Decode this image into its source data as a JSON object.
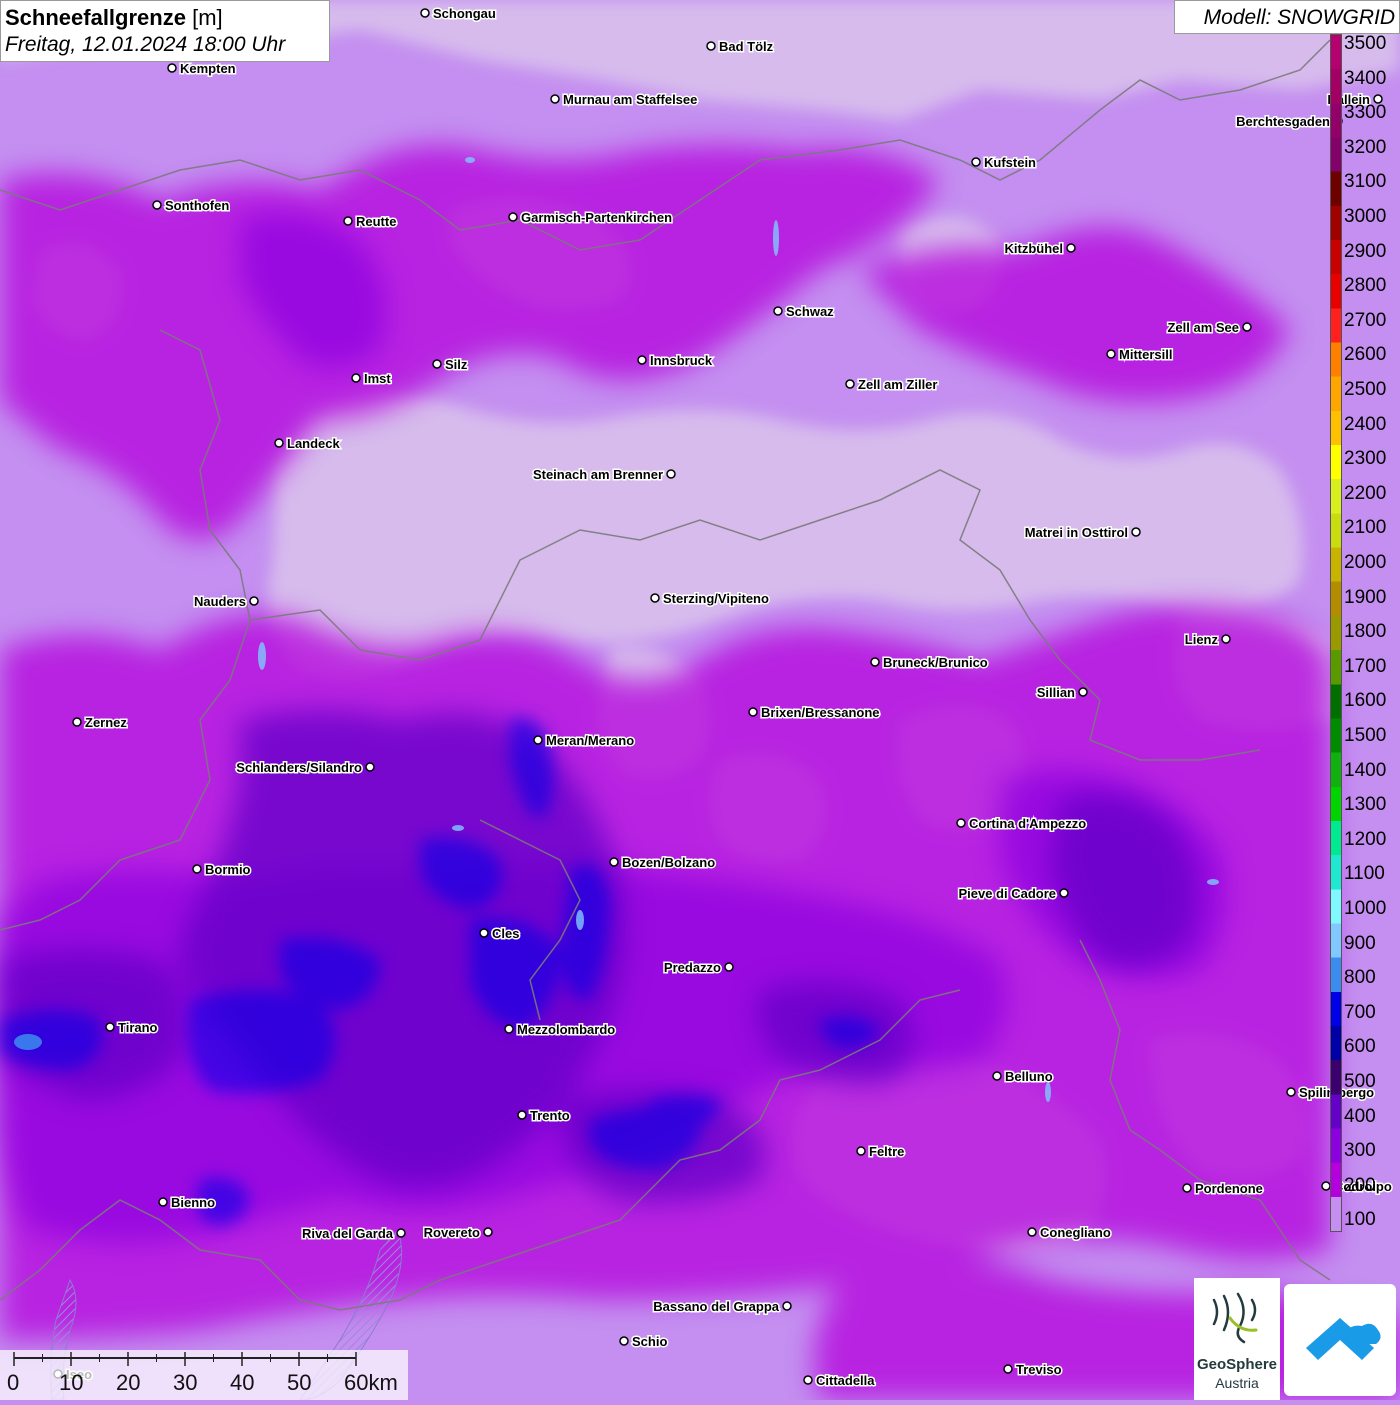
{
  "header": {
    "title": "Schneefallgrenze",
    "unit": "[m]",
    "datetime": "Freitag, 12.01.2024 18:00 Uhr"
  },
  "model": {
    "label": "Modell: SNOWGRID"
  },
  "legend": {
    "labels": [
      "3500",
      "3400",
      "3300",
      "3200",
      "3100",
      "3000",
      "2900",
      "2800",
      "2700",
      "2600",
      "2500",
      "2400",
      "2300",
      "2200",
      "2100",
      "2000",
      "1900",
      "1800",
      "1700",
      "1600",
      "1500",
      "1400",
      "1300",
      "1200",
      "1100",
      "1000",
      "900",
      "800",
      "700",
      "600",
      "500",
      "400",
      "300",
      "200",
      "100"
    ],
    "colors": [
      "#b5006f",
      "#a30066",
      "#94006a",
      "#84006b",
      "#6e0000",
      "#a00000",
      "#c80000",
      "#e80000",
      "#ff2020",
      "#ff8000",
      "#ffa500",
      "#ffc000",
      "#ffff00",
      "#d8f020",
      "#c8dc10",
      "#c8b400",
      "#b48c00",
      "#9a9a00",
      "#5a9a00",
      "#006e00",
      "#008c00",
      "#10b010",
      "#00d400",
      "#00e890",
      "#20e8d0",
      "#80f8ff",
      "#80c8ff",
      "#3c8cf0",
      "#0000e8",
      "#0000a8",
      "#3c006e",
      "#6400c8",
      "#8c00e0",
      "#b400dc",
      "#c48ff0"
    ]
  },
  "map": {
    "layer_colors": {
      "snowline_below_100": "#c48ff0",
      "snowline_100_200": "#b400dc",
      "snowline_200_300": "#8c00e0",
      "snowline_300_400": "#6400c8",
      "snowline_400_500": "#3c006e",
      "snowline_600_700": "#0000e8",
      "snowline_700_800": "#3c8cf0",
      "snow_free": "#e8e8e8",
      "borders": "#7a7a7a",
      "lakes": "#80c8ff"
    },
    "cities": [
      {
        "name": "Schongau"
      },
      {
        "name": "Bad Tölz"
      },
      {
        "name": "Kempten"
      },
      {
        "name": "Murnau am Staffelsee"
      },
      {
        "name": "Hallein"
      },
      {
        "name": "Berchtesgaden"
      },
      {
        "name": "Kufstein"
      },
      {
        "name": "Sonthofen"
      },
      {
        "name": "Reutte"
      },
      {
        "name": "Garmisch-Partenkirchen"
      },
      {
        "name": "Kitzbühel"
      },
      {
        "name": "Schwaz"
      },
      {
        "name": "Zell am See"
      },
      {
        "name": "Mittersill"
      },
      {
        "name": "Innsbruck"
      },
      {
        "name": "Imst"
      },
      {
        "name": "Silz"
      },
      {
        "name": "Zell am Ziller"
      },
      {
        "name": "Landeck"
      },
      {
        "name": "Steinach am Brenner"
      },
      {
        "name": "Matrei in Osttirol"
      },
      {
        "name": "Nauders"
      },
      {
        "name": "Sterzing/Vipiteno"
      },
      {
        "name": "Lienz"
      },
      {
        "name": "Bruneck/Brunico"
      },
      {
        "name": "Sillian"
      },
      {
        "name": "Zernez"
      },
      {
        "name": "Brixen/Bressanone"
      },
      {
        "name": "Meran/Merano"
      },
      {
        "name": "Schlanders/Silandro"
      },
      {
        "name": "Cortina d'Ampezzo"
      },
      {
        "name": "Bozen/Bolzano"
      },
      {
        "name": "Bormio"
      },
      {
        "name": "Pieve di Cadore"
      },
      {
        "name": "Cles"
      },
      {
        "name": "Predazzo"
      },
      {
        "name": "Tirano"
      },
      {
        "name": "Mezzolombardo"
      },
      {
        "name": "Belluno"
      },
      {
        "name": "Spilimbergo"
      },
      {
        "name": "Trento"
      },
      {
        "name": "Feltre"
      },
      {
        "name": "Pordenone"
      },
      {
        "name": "Codroipo"
      },
      {
        "name": "Bienno"
      },
      {
        "name": "Riva del Garda"
      },
      {
        "name": "Rovereto"
      },
      {
        "name": "Conegliano"
      },
      {
        "name": "Bassano del Grappa"
      },
      {
        "name": "Schio"
      },
      {
        "name": "Iseo"
      },
      {
        "name": "Treviso"
      },
      {
        "name": "Cittadella"
      }
    ]
  },
  "scale": {
    "labels": [
      "0",
      "10",
      "20",
      "30",
      "40",
      "50",
      "60km"
    ]
  },
  "logos": {
    "geosphere_name": "GeoSphere",
    "geosphere_sub": "Austria",
    "app_icon": "cloud-arrow-icon"
  }
}
